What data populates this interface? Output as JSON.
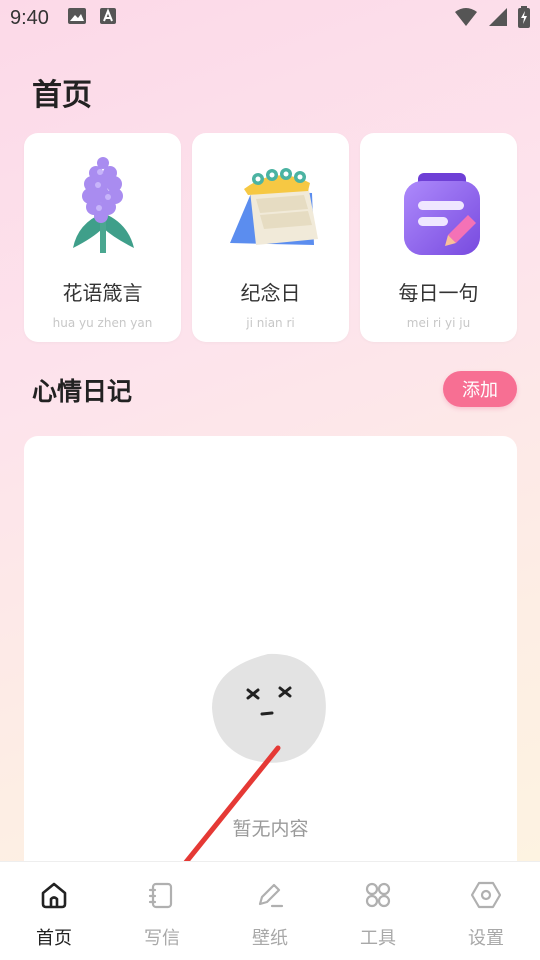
{
  "status_bar": {
    "time": "9:40"
  },
  "page_title": "首页",
  "cards": [
    {
      "title": "花语箴言",
      "subtitle": "hua yu zhen yan",
      "icon": "hyacinth-flower-icon"
    },
    {
      "title": "纪念日",
      "subtitle": "ji nian ri",
      "icon": "desk-calendar-icon"
    },
    {
      "title": "每日一句",
      "subtitle": "mei ri yi ju",
      "icon": "purple-notebook-icon"
    }
  ],
  "mood_diary": {
    "title": "心情日记",
    "add_label": "添加",
    "empty_text": "暂无内容"
  },
  "bottom_nav": {
    "items": [
      {
        "label": "首页",
        "icon": "home-icon",
        "active": true
      },
      {
        "label": "写信",
        "icon": "letter-icon",
        "active": false
      },
      {
        "label": "壁纸",
        "icon": "pen-icon",
        "active": false
      },
      {
        "label": "工具",
        "icon": "grid-icon",
        "active": false
      },
      {
        "label": "设置",
        "icon": "hexagon-settings-icon",
        "active": false
      }
    ]
  },
  "colors": {
    "accent": "#f76f93",
    "annotation_arrow": "#e53935"
  }
}
